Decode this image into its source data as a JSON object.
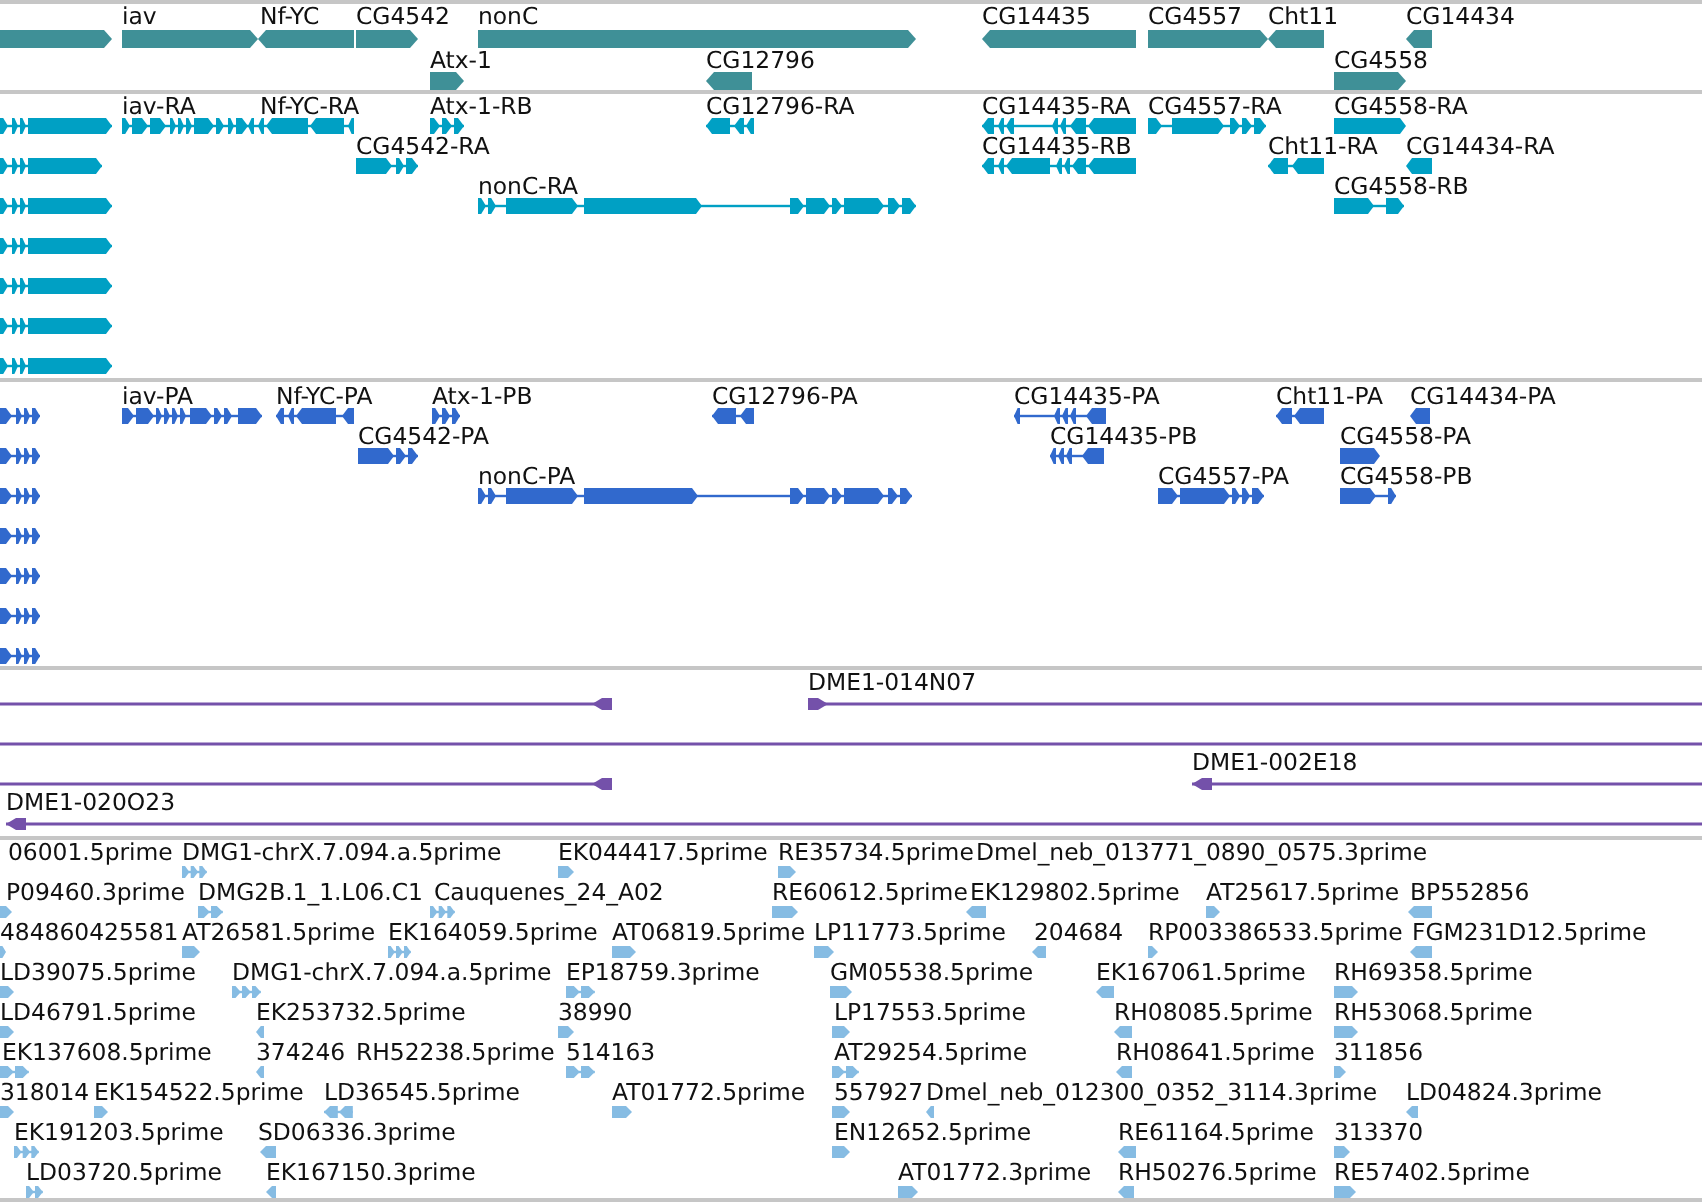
{
  "tracks": [
    {
      "kind": "gene",
      "features": [
        {
          "reverse": false
        },
        {
          "label": "iav",
          "reverse": false
        },
        {
          "label": "Nf-YC",
          "reverse": true
        },
        {
          "label": "CG4542",
          "reverse": false
        },
        {
          "label": "nonC",
          "reverse": false
        },
        {
          "label": "CG14435",
          "reverse": true
        },
        {
          "label": "CG4557",
          "reverse": false
        },
        {
          "label": "Cht11",
          "reverse": true
        },
        {
          "label": "CG14434",
          "reverse": true
        },
        {
          "label": "Atx-1",
          "reverse": false
        },
        {
          "label": "CG12796",
          "reverse": true
        },
        {
          "label": "CG4558",
          "reverse": false
        }
      ]
    },
    {
      "kind": "transcript",
      "features": [
        {
          "reverse": false
        },
        {
          "label": "iav-RA",
          "reverse": false
        },
        {
          "label": "Nf-YC-RA",
          "reverse": true
        },
        {
          "label": "Atx-1-RB",
          "reverse": false
        },
        {
          "label": "CG12796-RA",
          "reverse": true
        },
        {
          "label": "CG14435-RA",
          "reverse": true
        },
        {
          "label": "CG4557-RA",
          "reverse": false
        },
        {
          "label": "CG4558-RA",
          "reverse": false
        },
        {
          "reverse": false
        },
        {
          "label": "CG4542-RA",
          "reverse": false
        },
        {
          "label": "CG14435-RB",
          "reverse": true
        },
        {
          "label": "Cht11-RA",
          "reverse": true
        },
        {
          "label": "CG14434-RA",
          "reverse": true
        },
        {
          "reverse": false
        },
        {
          "label": "nonC-RA",
          "reverse": false
        },
        {
          "label": "CG4558-RB",
          "reverse": false
        },
        {
          "reverse": false
        },
        {
          "reverse": false
        },
        {
          "reverse": false
        },
        {
          "reverse": false
        }
      ]
    },
    {
      "kind": "protein",
      "features": [
        {
          "reverse": false
        },
        {
          "label": "iav-PA",
          "reverse": false
        },
        {
          "label": "Nf-YC-PA",
          "reverse": true
        },
        {
          "label": "Atx-1-PB",
          "reverse": false
        },
        {
          "label": "CG12796-PA",
          "reverse": true
        },
        {
          "label": "CG14435-PA",
          "reverse": true
        },
        {
          "label": "Cht11-PA",
          "reverse": true
        },
        {
          "label": "CG14434-PA",
          "reverse": true
        },
        {
          "reverse": false
        },
        {
          "label": "CG4542-PA",
          "reverse": false
        },
        {
          "label": "CG14435-PB",
          "reverse": true
        },
        {
          "label": "CG4558-PA",
          "reverse": false
        },
        {
          "reverse": false
        },
        {
          "label": "nonC-PA",
          "reverse": false
        },
        {
          "label": "CG4557-PA",
          "reverse": false
        },
        {
          "label": "CG4558-PB",
          "reverse": false
        },
        {
          "reverse": false
        },
        {
          "reverse": false
        },
        {
          "reverse": false
        },
        {
          "reverse": false
        }
      ]
    },
    {
      "kind": "clone",
      "features": [
        {
          "marked": true,
          "reverse": true
        },
        {
          "label": "DME1-014N07",
          "marked": true,
          "reverse": false
        },
        {
          "marked": false
        },
        {
          "marked": true,
          "reverse": true
        },
        {
          "label": "DME1-002E18",
          "marked": true,
          "reverse": true
        },
        {
          "label": "DME1-020O23",
          "marked": true,
          "reverse": true
        }
      ]
    },
    {
      "kind": "est",
      "features": [
        {
          "label": "06001.5prime"
        },
        {
          "label": "DMG1-chrX.7.094.a.5prime",
          "reverse": false
        },
        {
          "label": "EK044417.5prime",
          "reverse": false
        },
        {
          "label": "RE35734.5prime",
          "reverse": false
        },
        {
          "label": "Dmel_neb_013771_0890_0575.3prime"
        },
        {
          "label": "P09460.3prime",
          "reverse": false
        },
        {
          "label": "DMG2B.1_1.L06.C1",
          "reverse": false
        },
        {
          "label": "Cauquenes_24_A02",
          "reverse": false
        },
        {
          "label": "RE60612.5prime",
          "reverse": false
        },
        {
          "label": "EK129802.5prime",
          "reverse": true
        },
        {
          "label": "AT25617.5prime",
          "reverse": false
        },
        {
          "label": "BP552856",
          "reverse": true
        },
        {
          "label": "484860425581",
          "reverse": false
        },
        {
          "label": "AT26581.5prime",
          "reverse": false
        },
        {
          "label": "EK164059.5prime",
          "reverse": false
        },
        {
          "label": "AT06819.5prime",
          "reverse": false
        },
        {
          "label": "LP11773.5prime",
          "reverse": false
        },
        {
          "label": "204684",
          "reverse": true
        },
        {
          "label": "RP003386533.5prime",
          "reverse": false
        },
        {
          "label": "FGM231D12.5prime",
          "reverse": true
        },
        {
          "label": "LD39075.5prime",
          "reverse": false
        },
        {
          "label": "DMG1-chrX.7.094.a.5prime",
          "reverse": false
        },
        {
          "label": "EP18759.3prime",
          "reverse": false
        },
        {
          "label": "GM05538.5prime",
          "reverse": false
        },
        {
          "label": "EK167061.5prime",
          "reverse": true
        },
        {
          "label": "RH69358.5prime",
          "reverse": false
        },
        {
          "label": "LD46791.5prime",
          "reverse": false
        },
        {
          "label": "EK253732.5prime",
          "reverse": true
        },
        {
          "label": "38990",
          "reverse": false
        },
        {
          "label": "LP17553.5prime",
          "reverse": false
        },
        {
          "label": "RH08085.5prime",
          "reverse": true
        },
        {
          "label": "RH53068.5prime",
          "reverse": false
        },
        {
          "label": "EK137608.5prime",
          "reverse": false
        },
        {
          "label": "374246",
          "reverse": true
        },
        {
          "label": "RH52238.5prime"
        },
        {
          "label": "514163",
          "reverse": false
        },
        {
          "label": "AT29254.5prime",
          "reverse": false
        },
        {
          "label": "RH08641.5prime",
          "reverse": true
        },
        {
          "label": "311856",
          "reverse": false
        },
        {
          "label": "318014",
          "reverse": false
        },
        {
          "label": "EK154522.5prime",
          "reverse": false
        },
        {
          "label": "LD36545.5prime",
          "reverse": true
        },
        {
          "label": "AT01772.5prime",
          "reverse": false
        },
        {
          "label": "557927",
          "reverse": false
        },
        {
          "label": "Dmel_neb_012300_0352_3114.3prime",
          "reverse": true
        },
        {
          "label": "LD04824.3prime",
          "reverse": true
        },
        {
          "label": "EK191203.5prime",
          "reverse": false
        },
        {
          "label": "SD06336.3prime",
          "reverse": true
        },
        {
          "label": "EN12652.5prime",
          "reverse": false
        },
        {
          "label": "RE61164.5prime",
          "reverse": true
        },
        {
          "label": "313370",
          "reverse": false
        },
        {
          "label": "LD03720.5prime",
          "reverse": false
        },
        {
          "label": "EK167150.3prime",
          "reverse": true
        },
        {
          "label": "AT01772.3prime",
          "reverse": false
        },
        {
          "label": "RH50276.5prime",
          "reverse": true
        },
        {
          "label": "RE57402.5prime",
          "reverse": false
        }
      ]
    }
  ]
}
